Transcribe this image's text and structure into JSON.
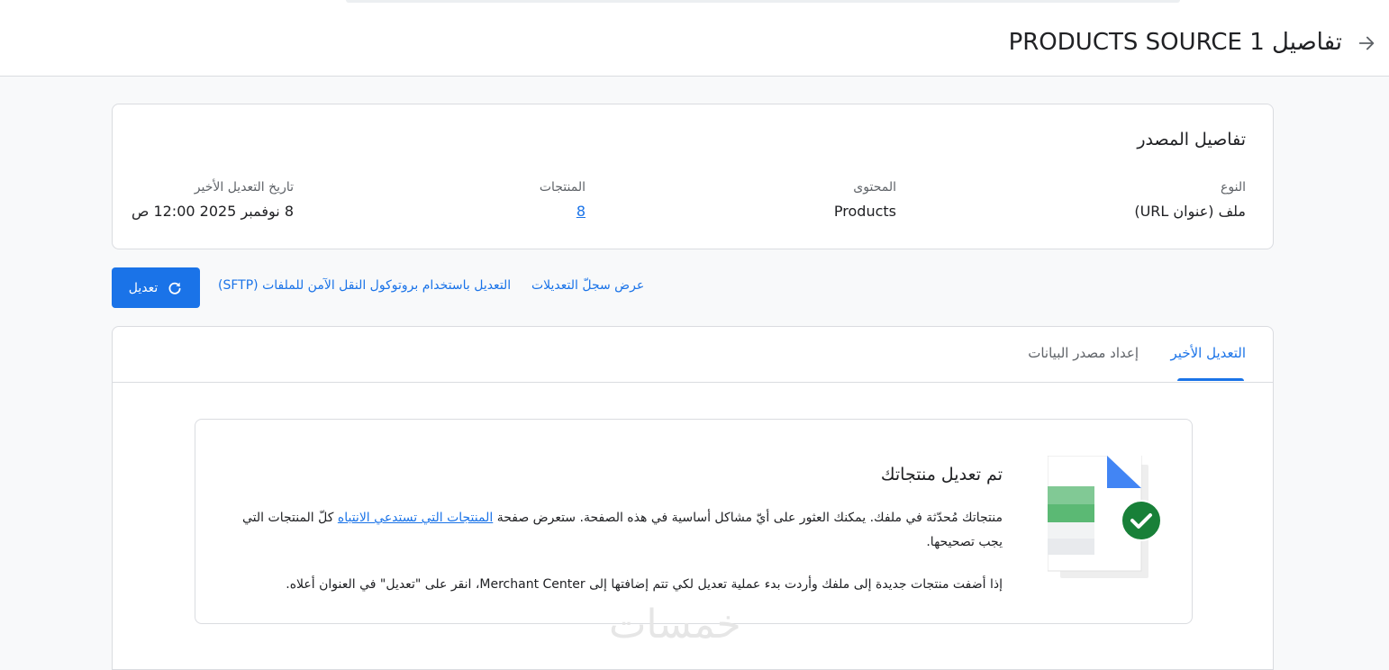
{
  "header": {
    "title": "تفاصيل PRODUCTS SOURCE 1",
    "back_icon": "arrow-back-icon"
  },
  "source_details": {
    "title": "تفاصيل المصدر",
    "type_label": "النوع",
    "type_value": "ملف (عنوان URL)",
    "content_label": "المحتوى",
    "content_value": "Products",
    "products_label": "المنتجات",
    "products_value": "8",
    "last_update_label": "تاريخ التعديل الأخير",
    "last_update_value": "8 نوفمبر 2025 12:00 ص"
  },
  "actions": {
    "refresh_label": "تعديل",
    "refresh_icon": "refresh-icon",
    "view_history": "عرض سجلّ التعديلات",
    "sftp_update": "التعديل باستخدام بروتوكول النقل الآمن للملفات (SFTP)"
  },
  "tabs": [
    {
      "label": "التعديل الأخير",
      "active": true
    },
    {
      "label": "إعداد مصدر البيانات",
      "active": false
    }
  ],
  "status": {
    "title": "تم تعديل منتجاتك",
    "p1_before": "منتجاتك مُحدّثة في ملفك. يمكنك العثور على أيّ مشاكل أساسية في هذه الصفحة. ستعرض صفحة ",
    "p1_link": "المنتجات التي تستدعي الانتباه",
    "p1_after": " كلّ المنتجات التي يجب تصحيحها.",
    "p2": "إذا أضفت منتجات جديدة إلى ملفك وأردت بدء عملية تعديل لكي تتم إضافتها إلى Merchant Center، انقر على \"تعديل\" في العنوان أعلاه.",
    "illustration_icon": "spreadsheet-success-icon"
  },
  "watermark": "خمسات",
  "colors": {
    "accent": "#1a73e8",
    "success": "#188038",
    "sheet_green": "#81c995"
  }
}
